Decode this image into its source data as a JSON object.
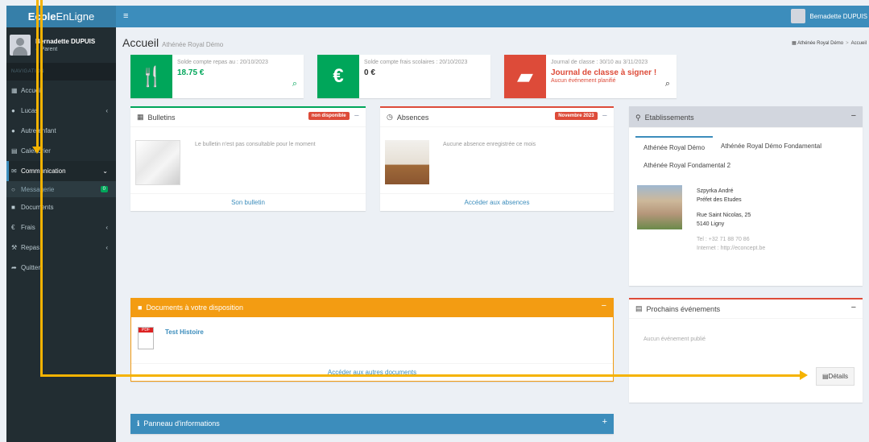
{
  "brand": {
    "bold": "Ecole",
    "rest": "EnLigne"
  },
  "user": {
    "name": "Bernadette DUPUIS",
    "role": "Parent",
    "top_name": "Bernadette DUPUIS"
  },
  "sidebar": {
    "header": "NAVIGATION",
    "items": [
      {
        "label": "Accueil",
        "icon": "grid-icon"
      },
      {
        "label": "Lucas",
        "icon": "user-icon"
      },
      {
        "label": "Autre enfant",
        "icon": "user-icon"
      },
      {
        "label": "Calendrier",
        "icon": "calendar-icon"
      },
      {
        "label": "Communication",
        "icon": "envelope-icon"
      },
      {
        "label": "Messagerie",
        "icon": "circle-icon",
        "badge": "0"
      },
      {
        "label": "Documents",
        "icon": "folder-icon"
      },
      {
        "label": "Frais",
        "icon": "euro-icon"
      },
      {
        "label": "Repas",
        "icon": "fork-knife-icon"
      },
      {
        "label": "Quitter",
        "icon": "share-icon"
      }
    ]
  },
  "header": {
    "title": "Accueil",
    "subtitle": "Athénée Royal Démo",
    "breadcrumb": [
      "Athénée Royal Démo",
      "Accueil"
    ]
  },
  "info_boxes": [
    {
      "text": "Solde compte repas au : 20/10/2023",
      "value": "18.75 €",
      "color": "#00a65a"
    },
    {
      "text": "Solde compte frais scolaires : 20/10/2023",
      "value": "0 €",
      "color": "#00a65a"
    },
    {
      "text": "Journal de classe : 30/10 au 3/11/2023",
      "value": "Journal de classe à signer !",
      "note": "Aucun événement planifié",
      "color": "#dd4b39"
    }
  ],
  "bulletins": {
    "title": "Bulletins",
    "badge": "non disponible",
    "text": "Le bulletin n'est pas consultable pour le moment",
    "footer": "Son bulletin"
  },
  "absences": {
    "title": "Absences",
    "badge": "Novembre 2023",
    "text": "Aucune absence enregistrée ce mois",
    "footer": "Accéder aux absences"
  },
  "etablissements": {
    "title": "Etablissements",
    "tabs": [
      "Athénée Royal Démo",
      "Athénée Royal Démo Fondamental",
      "Athénée Royal Fondamental 2"
    ],
    "contact_name": "Szpyrka André",
    "contact_role": "Préfet des Etudes",
    "address1": "Rue Saint Nicolas, 25",
    "address2": "5140 Ligny",
    "tel": "Tel : +32 71 88 70 86",
    "internet": "Internet : http://econcept.be"
  },
  "documents": {
    "title": "Documents à votre disposition",
    "item": "Test Histoire",
    "footer": "Accéder aux autres documents"
  },
  "events": {
    "title": "Prochains événements",
    "empty": "Aucun événement publié",
    "details": "Détails"
  },
  "info_panel": {
    "title": "Panneau d'informations"
  },
  "colors": {
    "accent": "#3c8dbc",
    "green": "#00a65a",
    "red": "#dd4b39",
    "orange": "#f39c12",
    "sidebar": "#222d32"
  }
}
